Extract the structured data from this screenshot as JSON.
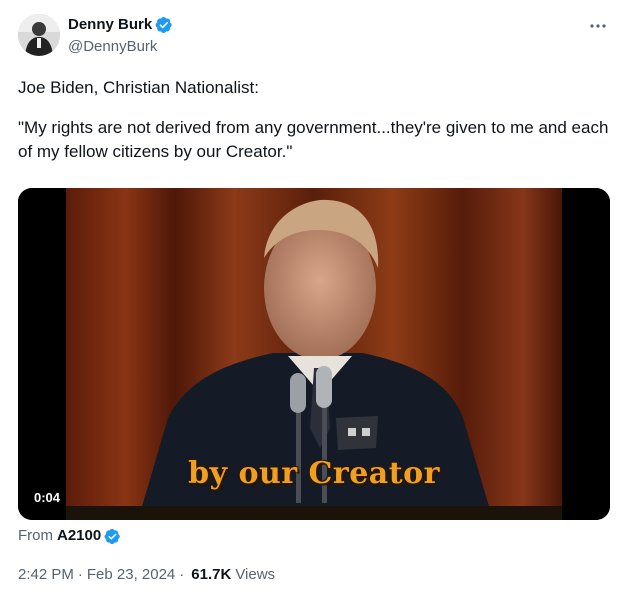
{
  "author": {
    "display_name": "Denny Burk",
    "handle": "@DennyBurk",
    "verified": true,
    "verified_color": "#1d9bf0"
  },
  "tweet": {
    "line1": "Joe Biden, Christian Nationalist:",
    "line2": "\"My rights are not derived from any government...they're given to me and each of my fellow citizens by our Creator.\""
  },
  "media": {
    "caption": "by our Creator",
    "duration": "0:04",
    "caption_color": "#f0a020"
  },
  "source": {
    "prefix": "From",
    "name": "A2100",
    "verified": true
  },
  "meta": {
    "time": "2:42 PM",
    "separator": "·",
    "date": "Feb 23, 2024",
    "views_count": "61.7K",
    "views_label": "Views"
  },
  "icons": {
    "more": "more-dots-icon",
    "verified": "verified-badge-icon"
  }
}
